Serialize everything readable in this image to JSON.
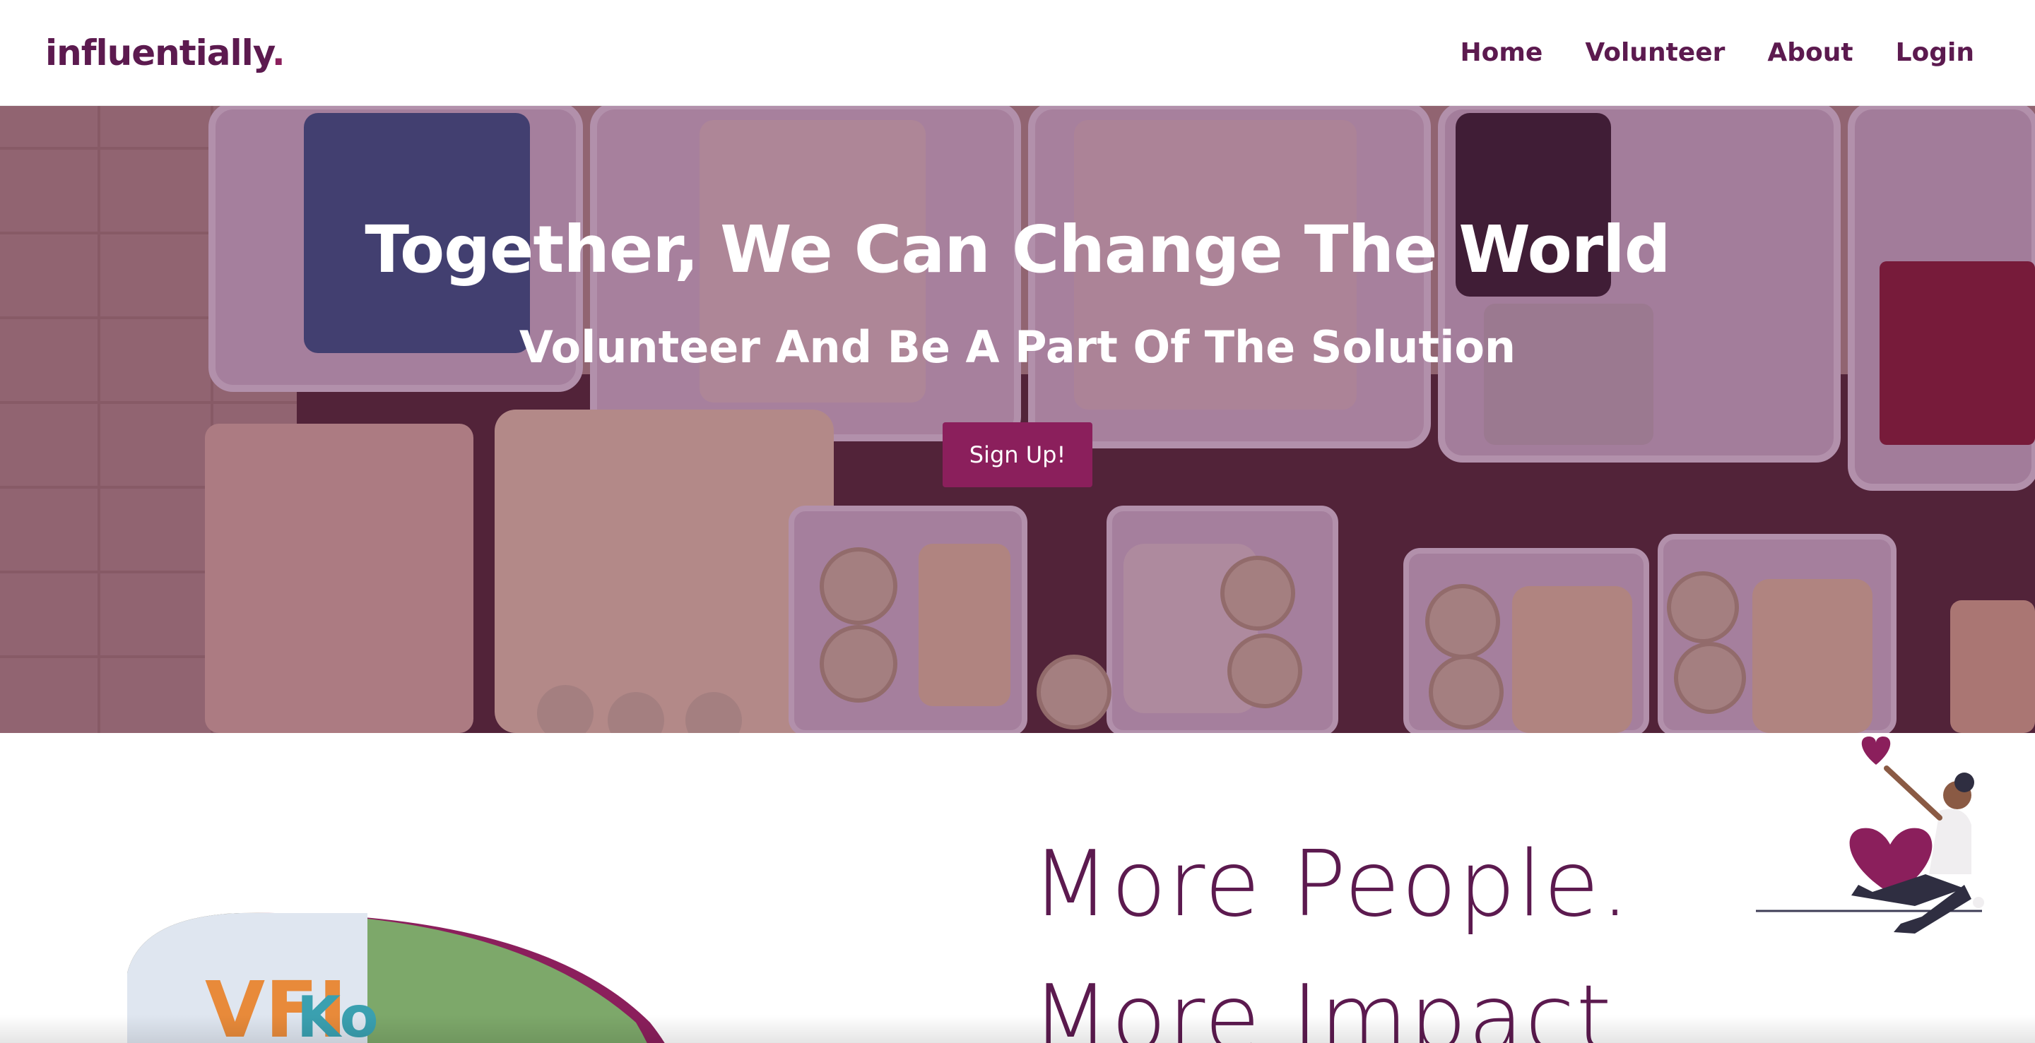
{
  "brand": {
    "name": "influentially",
    "dot": "."
  },
  "nav": {
    "items": [
      {
        "label": "Home"
      },
      {
        "label": "Volunteer"
      },
      {
        "label": "About"
      },
      {
        "label": "Login"
      }
    ]
  },
  "hero": {
    "title": "Together, We Can Change The World",
    "subtitle": "Volunteer And Be A Part Of The Solution",
    "cta_label": "Sign Up!"
  },
  "impact": {
    "line1": "More People.",
    "line2": "More Impact"
  },
  "colors": {
    "brand": "#5c1a4f",
    "accent": "#8b1f5c",
    "overlay": "#5c1a4f"
  },
  "icons": {
    "illustration": "volunteer-heart-illustration",
    "hero_image": "donation-bins-photo"
  }
}
